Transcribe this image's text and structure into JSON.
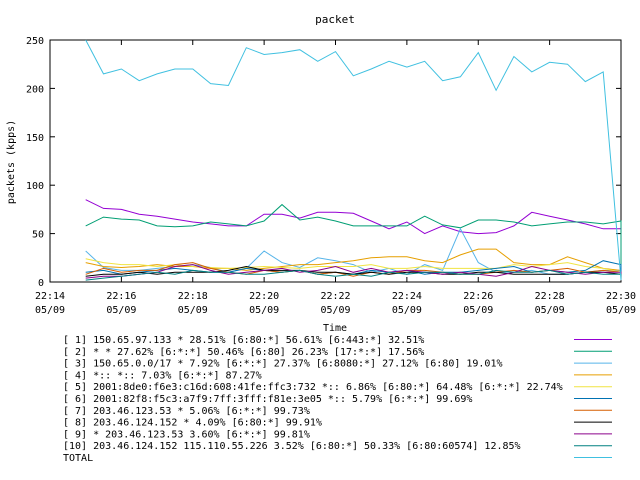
{
  "chart_data": {
    "type": "line",
    "title": "packet",
    "xlabel": "Time",
    "ylabel": "packets (kpps)",
    "ylim": [
      0,
      250
    ],
    "yticks": [
      0,
      50,
      100,
      150,
      200,
      250
    ],
    "xlim_minutes": [
      0,
      16
    ],
    "xtick_minutes": [
      0,
      2,
      4,
      6,
      8,
      10,
      12,
      14,
      16
    ],
    "xtick_labels": [
      {
        "time": "22:14",
        "date": "05/09"
      },
      {
        "time": "22:16",
        "date": "05/09"
      },
      {
        "time": "22:18",
        "date": "05/09"
      },
      {
        "time": "22:20",
        "date": "05/09"
      },
      {
        "time": "22:22",
        "date": "05/09"
      },
      {
        "time": "22:24",
        "date": "05/09"
      },
      {
        "time": "22:26",
        "date": "05/09"
      },
      {
        "time": "22:28",
        "date": "05/09"
      },
      {
        "time": "22:30",
        "date": "05/09"
      }
    ],
    "x_start_minute": 1,
    "x_step_minutes": 0.5,
    "series": [
      {
        "label": "[ 1] 150.65.97.133 * 28.51%  [6:80:*] 56.61% [6:443:*] 32.51%",
        "color": "#9400d3",
        "values": [
          85,
          76,
          75,
          70,
          68,
          65,
          62,
          60,
          58,
          58,
          70,
          70,
          66,
          72,
          72,
          71,
          63,
          55,
          62,
          50,
          58,
          52,
          50,
          51,
          58,
          72,
          68,
          64,
          60,
          55,
          55,
          2
        ]
      },
      {
        "label": "[ 2] * * 27.62%  [6:*:*] 50.46% [6:80] 26.23% [17:*:*] 17.56%",
        "color": "#009e73",
        "values": [
          58,
          67,
          65,
          64,
          58,
          57,
          58,
          62,
          60,
          58,
          63,
          80,
          64,
          67,
          63,
          58,
          58,
          58,
          58,
          68,
          59,
          56,
          64,
          64,
          62,
          58,
          60,
          62,
          62,
          60,
          63,
          2
        ]
      },
      {
        "label": "[ 3] 150.65.0.0/17 * 7.92%  [6:*:*] 27.37% [6:8080:*] 27.12% [6:80] 19.01%",
        "color": "#56b4e9",
        "values": [
          32,
          15,
          12,
          12,
          14,
          16,
          18,
          15,
          10,
          14,
          32,
          20,
          15,
          25,
          22,
          18,
          10,
          14,
          8,
          18,
          12,
          55,
          20,
          10,
          10,
          12,
          8,
          8,
          10,
          12,
          12,
          2
        ]
      },
      {
        "label": "[ 4] *:: *:: 7.03%  [6:*:*] 87.27%",
        "color": "#e69f00",
        "values": [
          20,
          16,
          15,
          16,
          18,
          16,
          16,
          14,
          14,
          12,
          14,
          16,
          18,
          18,
          20,
          22,
          25,
          26,
          26,
          22,
          20,
          28,
          34,
          34,
          20,
          18,
          18,
          26,
          20,
          14,
          12,
          2
        ]
      },
      {
        "label": "[ 5] 2001:8de0:f6e3:c16d:608:41fe:ffc3:732 *:: 6.86%  [6:80:*] 64.48% [6:*:*] 22.74%",
        "color": "#f0e442",
        "values": [
          24,
          20,
          18,
          18,
          16,
          18,
          16,
          15,
          14,
          15,
          16,
          15,
          14,
          16,
          16,
          16,
          18,
          14,
          14,
          16,
          14,
          14,
          14,
          14,
          18,
          16,
          18,
          20,
          16,
          14,
          10,
          2
        ]
      },
      {
        "label": "[ 6] 2001:82f8:f5c3:a7f9:7ff:3fff:f81e:3e05 *:: 5.79%  [6:*:*] 99.69%",
        "color": "#0072b2",
        "values": [
          10,
          12,
          8,
          10,
          12,
          14,
          12,
          10,
          10,
          14,
          12,
          10,
          12,
          8,
          10,
          8,
          12,
          10,
          12,
          8,
          10,
          10,
          12,
          14,
          16,
          10,
          12,
          10,
          12,
          22,
          18,
          2
        ]
      },
      {
        "label": "[ 7] 203.46.123.53 * 5.06%  [6:*:*] 99.73%",
        "color": "#d55e00",
        "values": [
          8,
          14,
          10,
          12,
          12,
          18,
          20,
          14,
          10,
          8,
          12,
          10,
          12,
          8,
          10,
          6,
          10,
          8,
          12,
          12,
          10,
          8,
          8,
          10,
          12,
          10,
          12,
          14,
          10,
          12,
          10,
          2
        ]
      },
      {
        "label": "[ 8] 203.46.124.152 * 4.09%  [6:80:*] 99.91%",
        "color": "#000000",
        "values": [
          6,
          8,
          8,
          10,
          8,
          10,
          10,
          10,
          12,
          16,
          12,
          12,
          12,
          10,
          10,
          8,
          10,
          8,
          10,
          10,
          8,
          8,
          10,
          10,
          8,
          8,
          8,
          8,
          10,
          10,
          8,
          2
        ]
      },
      {
        "label": "[ 9] * 203.46.123.53 3.60%  [6:*:*] 99.81%",
        "color": "#8b008b",
        "values": [
          4,
          6,
          6,
          8,
          10,
          16,
          18,
          12,
          8,
          10,
          12,
          14,
          10,
          12,
          16,
          10,
          14,
          10,
          12,
          10,
          8,
          10,
          8,
          6,
          10,
          16,
          12,
          10,
          8,
          10,
          10,
          2
        ]
      },
      {
        "label": "[10] 203.46.124.152 115.110.55.226 3.52%  [6:80:*] 50.33% [6:80:60574] 12.85%",
        "color": "#008080",
        "values": [
          2,
          4,
          6,
          8,
          10,
          8,
          12,
          10,
          10,
          8,
          8,
          10,
          12,
          8,
          6,
          8,
          6,
          10,
          8,
          10,
          10,
          8,
          8,
          12,
          10,
          10,
          12,
          8,
          10,
          8,
          8,
          2
        ]
      },
      {
        "label": "TOTAL",
        "color": "#40c0e0",
        "values": [
          250,
          215,
          220,
          208,
          215,
          220,
          220,
          205,
          203,
          242,
          235,
          237,
          240,
          228,
          238,
          213,
          220,
          228,
          222,
          228,
          208,
          212,
          237,
          198,
          233,
          217,
          227,
          225,
          207,
          217,
          2
        ]
      }
    ]
  }
}
